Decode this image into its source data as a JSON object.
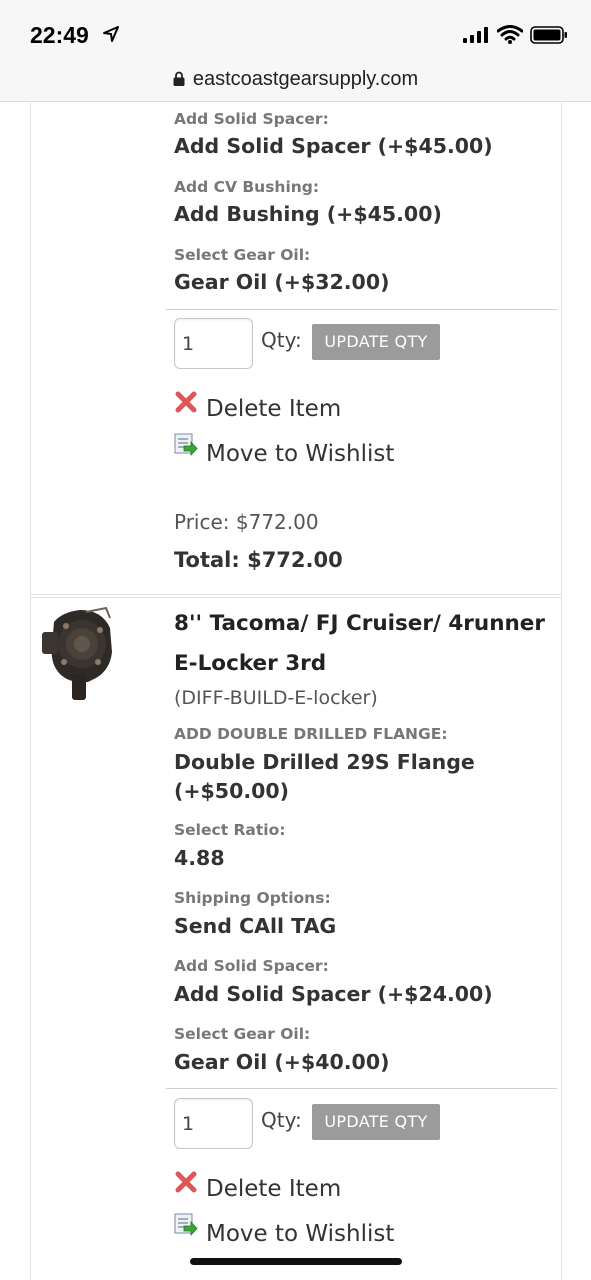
{
  "status": {
    "time": "22:49",
    "icons": [
      "location-arrow-icon",
      "cellular-signal-icon",
      "wifi-icon",
      "battery-icon"
    ]
  },
  "browser": {
    "url": "eastcoastgearsupply.com"
  },
  "item1": {
    "options": [
      {
        "label": "Add Solid Spacer:",
        "value": "Add Solid Spacer (+$45.00)"
      },
      {
        "label": "Add CV Bushing:",
        "value": "Add Bushing (+$45.00)"
      },
      {
        "label": "Select Gear Oil:",
        "value": "Gear Oil (+$32.00)"
      }
    ],
    "qty": "1",
    "qty_label": "Qty:",
    "update_label": "UPDATE QTY",
    "delete_label": "Delete Item",
    "wishlist_label": "Move to Wishlist",
    "price": "Price: $772.00",
    "total": "Total: $772.00"
  },
  "item2": {
    "title": "8'' Tacoma/ FJ Cruiser/ 4runner E-Locker 3rd",
    "sku": "(DIFF-BUILD-E-locker)",
    "options": [
      {
        "label": "ADD DOUBLE DRILLED FLANGE:",
        "value": "Double Drilled 29S Flange (+$50.00)"
      },
      {
        "label": "Select Ratio:",
        "value": "4.88"
      },
      {
        "label": "Shipping Options:",
        "value": "Send CAll TAG"
      },
      {
        "label": "Add Solid Spacer:",
        "value": "Add Solid Spacer (+$24.00)"
      },
      {
        "label": "Select Gear Oil:",
        "value": "Gear Oil (+$40.00)"
      }
    ],
    "qty": "1",
    "qty_label": "Qty:",
    "update_label": "UPDATE QTY",
    "delete_label": "Delete Item",
    "wishlist_label": "Move to Wishlist"
  },
  "colors": {
    "update_button": "#9b9b9b",
    "delete_icon": "#e05555",
    "label_gray": "#777777"
  }
}
